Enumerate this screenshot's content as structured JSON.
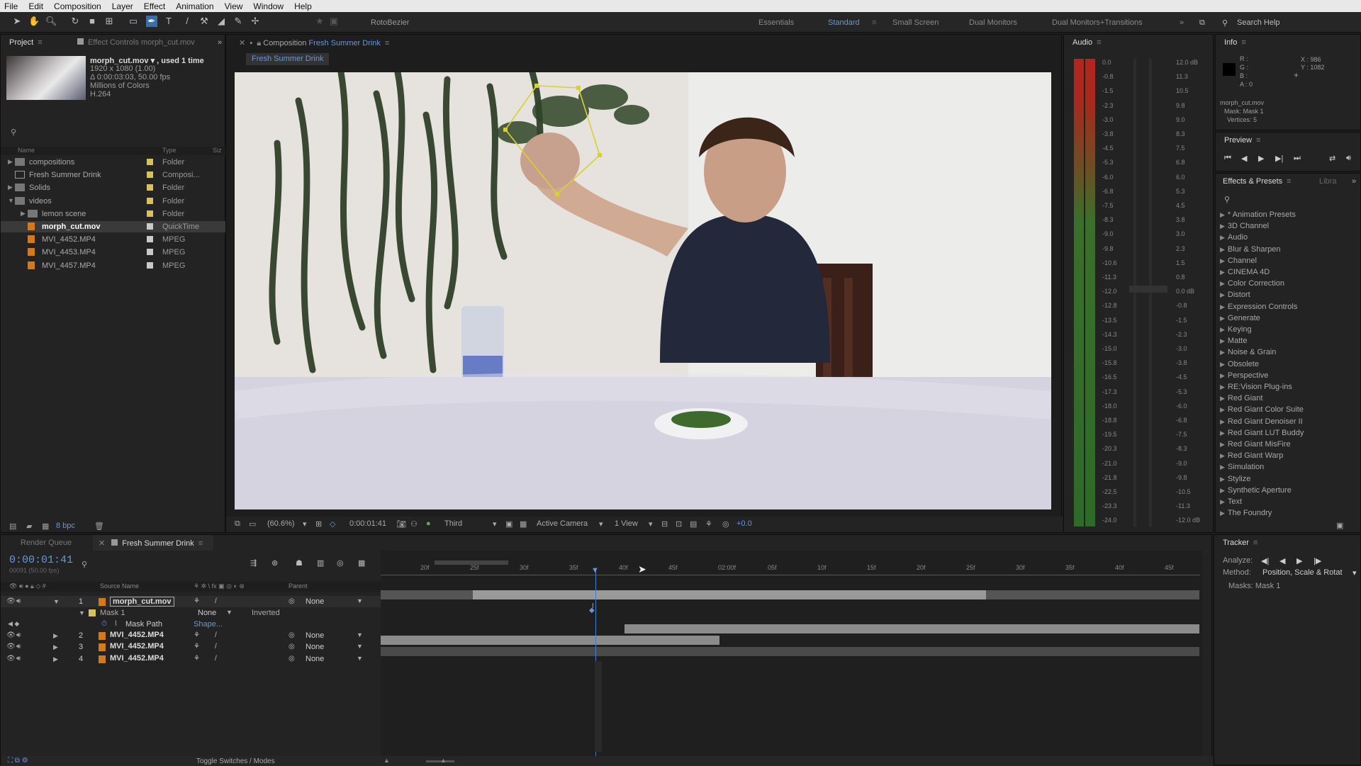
{
  "menu": [
    "File",
    "Edit",
    "Composition",
    "Layer",
    "Effect",
    "Animation",
    "View",
    "Window",
    "Help"
  ],
  "toolbar": {
    "tool_label": "RotoBezier",
    "search_help": "Search Help"
  },
  "workspaces": [
    {
      "label": "Essentials",
      "active": false
    },
    {
      "label": "Standard",
      "active": true
    },
    {
      "label": "Small Screen",
      "active": false
    },
    {
      "label": "Dual Monitors",
      "active": false
    },
    {
      "label": "Dual Monitors+Transitions",
      "active": false
    }
  ],
  "project": {
    "tab": "Project",
    "effect_controls_tab": "Effect Controls morph_cut.mov",
    "file_name": "morph_cut.mov ▾ , used 1 time",
    "file_res": "1920 x 1080 (1.00)",
    "file_dur": "Δ 0:00:03:03, 50.00 fps",
    "file_colors": "Millions of Colors",
    "file_codec": "H.264",
    "col_name": "Name",
    "col_type": "Type",
    "col_size": "Siz",
    "bpc": "8 bpc",
    "items": [
      {
        "indent": 0,
        "expand": "▶",
        "kind": "folder",
        "name": "compositions",
        "type": "Folder",
        "swatch": "#d9c15a",
        "selected": false
      },
      {
        "indent": 0,
        "expand": "",
        "kind": "comp",
        "name": "Fresh Summer Drink",
        "type": "Composi...",
        "swatch": "#d9c15a",
        "selected": false
      },
      {
        "indent": 0,
        "expand": "▶",
        "kind": "folder",
        "name": "Solids",
        "type": "Folder",
        "swatch": "#d9c15a",
        "selected": false
      },
      {
        "indent": 0,
        "expand": "▼",
        "kind": "folder",
        "name": "videos",
        "type": "Folder",
        "swatch": "#d9c15a",
        "selected": false
      },
      {
        "indent": 1,
        "expand": "▶",
        "kind": "folder",
        "name": "lemon scene",
        "type": "Folder",
        "swatch": "#d9c15a",
        "selected": false
      },
      {
        "indent": 1,
        "expand": "",
        "kind": "footage",
        "name": "morph_cut.mov",
        "type": "QuickTime",
        "swatch": "#c9c9c9",
        "selected": true
      },
      {
        "indent": 1,
        "expand": "",
        "kind": "footage",
        "name": "MVI_4452.MP4",
        "type": "MPEG",
        "swatch": "#c9c9c9",
        "selected": false
      },
      {
        "indent": 1,
        "expand": "",
        "kind": "footage",
        "name": "MVI_4453.MP4",
        "type": "MPEG",
        "swatch": "#c9c9c9",
        "selected": false
      },
      {
        "indent": 1,
        "expand": "",
        "kind": "footage",
        "name": "MVI_4457.MP4",
        "type": "MPEG",
        "swatch": "#c9c9c9",
        "selected": false
      }
    ]
  },
  "composition": {
    "tab_prefix": "Composition",
    "tab_name": "Fresh Summer Drink",
    "sub_tab": "Fresh Summer Drink",
    "zoom": "(60.6%)",
    "timecode": "0:00:01:41",
    "resolution": "Third",
    "camera": "Active Camera",
    "view": "1 View",
    "exposure": "+0.0"
  },
  "audio": {
    "tab": "Audio",
    "left_labels": [
      "0.0",
      "-0.8",
      "-1.5",
      "-2.3",
      "-3.0",
      "-3.8",
      "-4.5",
      "-5.3",
      "-6.0",
      "-6.8",
      "-7.5",
      "-8.3",
      "-9.0",
      "-9.8",
      "-10.6",
      "-11.3",
      "-12.0",
      "-12.8",
      "-13.5",
      "-14.3",
      "-15.0",
      "-15.8",
      "-16.5",
      "-17.3",
      "-18.0",
      "-18.8",
      "-19.5",
      "-20.3",
      "-21.0",
      "-21.8",
      "-22.5",
      "-23.3",
      "-24.0"
    ],
    "right_labels": [
      "12.0 dB",
      "11.3",
      "10.5",
      "9.8",
      "9.0",
      "8.3",
      "7.5",
      "6.8",
      "6.0",
      "5.3",
      "4.5",
      "3.8",
      "3.0",
      "2.3",
      "1.5",
      "0.8",
      "0.0 dB",
      "-0.8",
      "-1.5",
      "-2.3",
      "-3.0",
      "-3.8",
      "-4.5",
      "-5.3",
      "-6.0",
      "-6.8",
      "-7.5",
      "-8.3",
      "-9.0",
      "-9.8",
      "-10.5",
      "-11.3",
      "-12.0 dB"
    ]
  },
  "info": {
    "tab": "Info",
    "r": "R :",
    "g": "G :",
    "b": "B :",
    "a": "A : 0",
    "x": "X : 986",
    "y": "Y : 1082",
    "layer": "morph_cut.mov",
    "mask": "Mask: Mask 1",
    "vertices": "Vertices: 5"
  },
  "preview": {
    "tab": "Preview"
  },
  "effects": {
    "tab": "Effects & Presets",
    "lib_tab": "Libra",
    "items": [
      "* Animation Presets",
      "3D Channel",
      "Audio",
      "Blur & Sharpen",
      "Channel",
      "CINEMA 4D",
      "Color Correction",
      "Distort",
      "Expression Controls",
      "Generate",
      "Keying",
      "Matte",
      "Noise & Grain",
      "Obsolete",
      "Perspective",
      "RE:Vision Plug-ins",
      "Red Giant",
      "Red Giant Color Suite",
      "Red Giant Denoiser II",
      "Red Giant LUT Buddy",
      "Red Giant MisFire",
      "Red Giant Warp",
      "Simulation",
      "Stylize",
      "Synthetic Aperture",
      "Text",
      "The Foundry"
    ]
  },
  "timeline": {
    "render_queue_tab": "Render Queue",
    "comp_tab": "Fresh Summer Drink",
    "timecode": "0:00:01:41",
    "frame_info": "00091 (50.00 fps)",
    "col_source": "Source Name",
    "col_parent": "Parent",
    "toggle_label": "Toggle Switches / Modes",
    "ruler": [
      "20f",
      "25f",
      "30f",
      "35f",
      "40f",
      "45f",
      "02:00f",
      "05f",
      "10f",
      "15f",
      "20f",
      "25f",
      "30f",
      "35f",
      "40f",
      "45f"
    ],
    "mask_name": "Mask 1",
    "mask_mode": "None",
    "mask_inverted": "Inverted",
    "mask_path": "Mask Path",
    "mask_shape": "Shape...",
    "layers": [
      {
        "num": "1",
        "name": "morph_cut.mov",
        "parent": "None",
        "selected": true
      },
      {
        "num": "2",
        "name": "MVI_4452.MP4",
        "parent": "None",
        "selected": false
      },
      {
        "num": "3",
        "name": "MVI_4452.MP4",
        "parent": "None",
        "selected": false
      },
      {
        "num": "4",
        "name": "MVI_4452.MP4",
        "parent": "None",
        "selected": false
      }
    ]
  },
  "tracker": {
    "tab": "Tracker",
    "analyze": "Analyze:",
    "method_label": "Method:",
    "method_value": "Position, Scale & Rotat",
    "masks": "Masks: Mask 1"
  }
}
